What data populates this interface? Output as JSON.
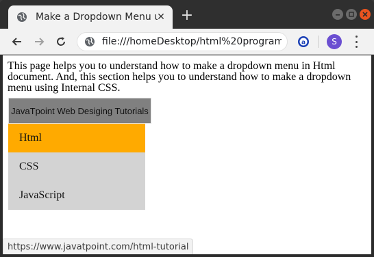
{
  "browser": {
    "tab_title": "Make a Dropdown Menu u",
    "tab_favicon": "globe-icon",
    "new_tab_symbol": "+",
    "close_symbol": "✕",
    "address": "file:///homeDesktop/html%20program...",
    "profile_initial": "S",
    "profile_color": "#6b4fd1",
    "close_button_color": "#e9541f",
    "status_url": "https://www.javatpoint.com/html-tutorial"
  },
  "page": {
    "intro": "This page helps you to understand how to make a dropdown menu in Html document. And, this section helps you to understand how to make a dropdown menu using Internal CSS.",
    "dropdown_label": "JavaTpoint Web Desiging Tutorials",
    "dropdown_color": "#808080",
    "menu_items": [
      {
        "label": "Html",
        "hovered": true
      },
      {
        "label": "CSS",
        "hovered": false
      },
      {
        "label": "JavaScript",
        "hovered": false
      }
    ],
    "menu_hover_color": "#ffaa00",
    "menu_bg_color": "#d3d3d3"
  }
}
